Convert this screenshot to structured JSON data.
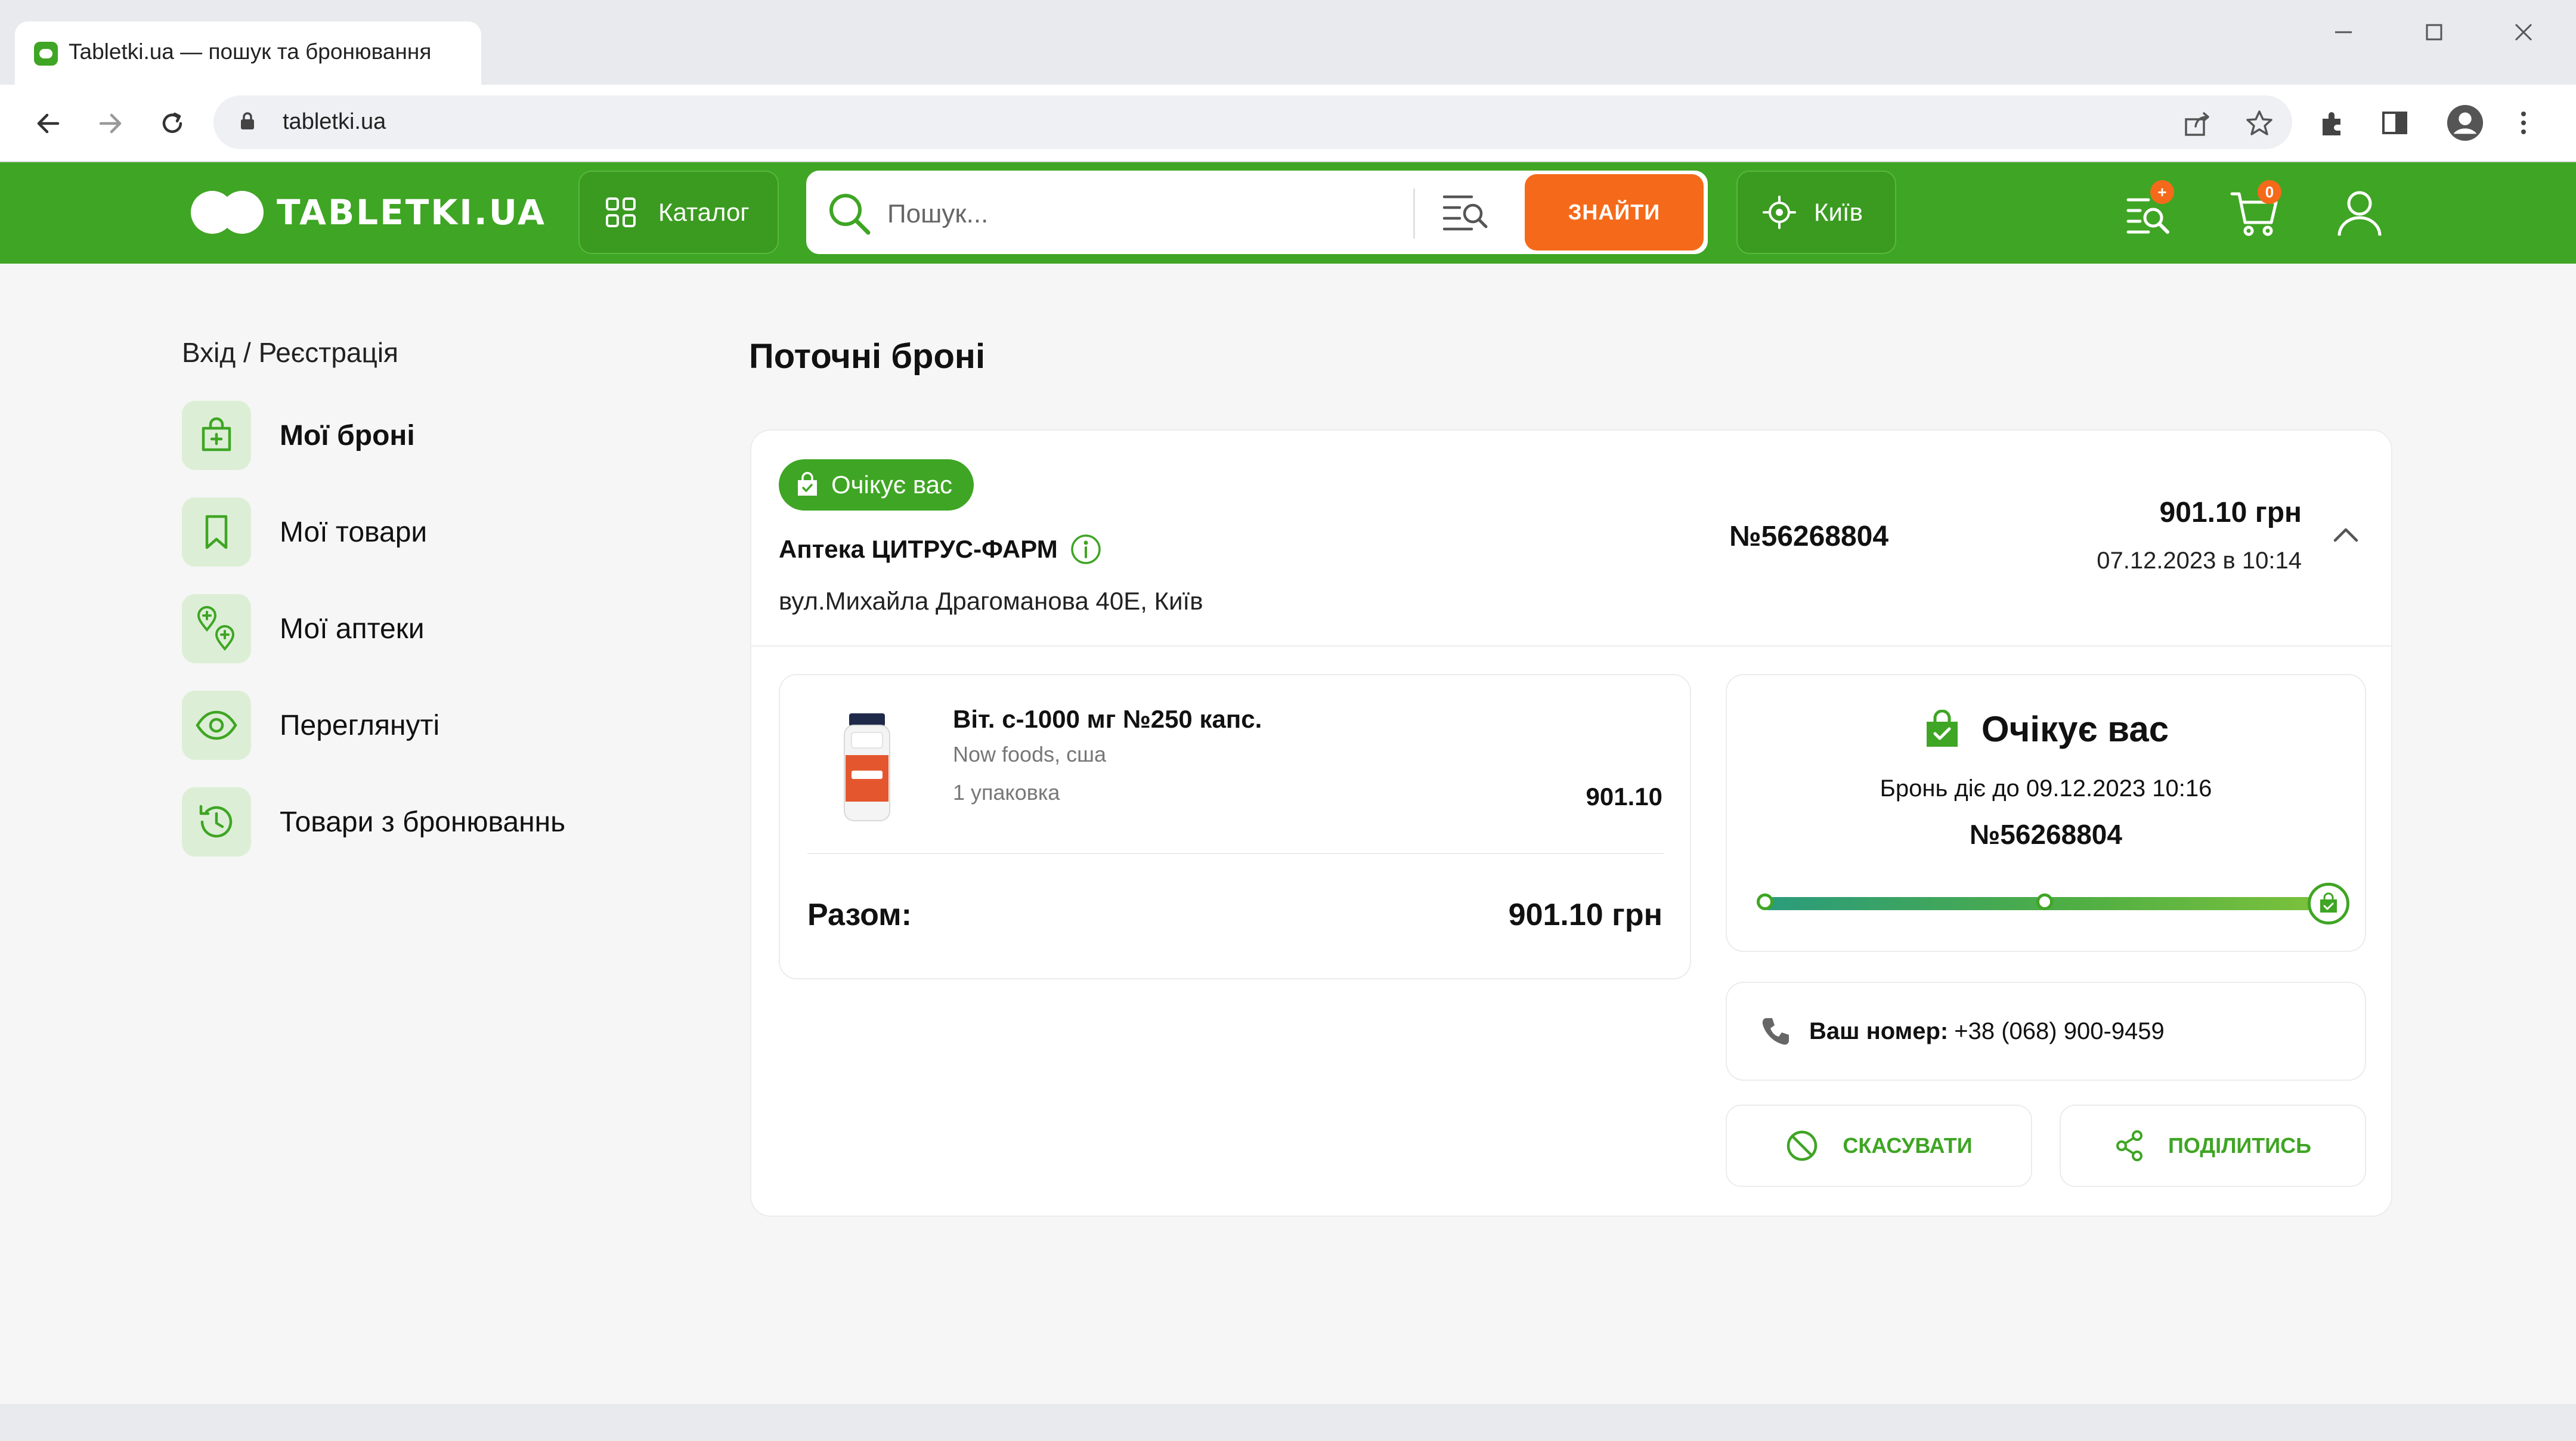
{
  "browser": {
    "tab_title": "Tabletki.ua — пошук та бронювання",
    "url": "tabletki.ua"
  },
  "header": {
    "logo_text": "TABLETKI.UA",
    "catalog_label": "Каталог",
    "search_placeholder": "Пошук...",
    "find_label": "ЗНАЙТИ",
    "city_label": "Київ",
    "history_badge": "+",
    "cart_badge": "0",
    "brand_color": "#3fa524",
    "accent_color": "#f56a1a"
  },
  "sidebar": {
    "login_link": "Вхід / Реєстрація",
    "items": [
      {
        "label": "Мої броні",
        "icon": "bag-plus-icon",
        "active": true
      },
      {
        "label": "Мої товари",
        "icon": "bookmark-icon",
        "active": false
      },
      {
        "label": "Мої аптеки",
        "icon": "pharmacy-pins-icon",
        "active": false
      },
      {
        "label": "Переглянуті",
        "icon": "eye-icon",
        "active": false
      },
      {
        "label": "Товари з бронюваннь",
        "icon": "history-icon",
        "active": false
      }
    ]
  },
  "main": {
    "title": "Поточні броні",
    "order": {
      "status": "Очікує вас",
      "pharmacy_name": "Аптека ЦИТРУС-ФАРМ",
      "pharmacy_address": "вул.Михайла Драгоманова 40Е, Київ",
      "number": "№56268804",
      "sum": "901.10 грн",
      "date": "07.12.2023 в 10:14",
      "items": [
        {
          "name": "Віт. с-1000 мг №250 капс.",
          "maker": "Now foods, сша",
          "qty": "1 упаковка",
          "price": "901.10"
        }
      ],
      "total_label": "Разом:",
      "total_value": "901.10 грн",
      "status_box": {
        "title": "Очікує вас",
        "valid_until": "Бронь діє до 09.12.2023 10:16",
        "number": "№56268804",
        "progress_fraction": 1.0
      },
      "phone_label": "Ваш номер:",
      "phone_value": "+38 (068) 900-9459",
      "cancel_label": "СКАСУВАТИ",
      "share_label": "ПОДІЛИТИСЬ"
    }
  }
}
